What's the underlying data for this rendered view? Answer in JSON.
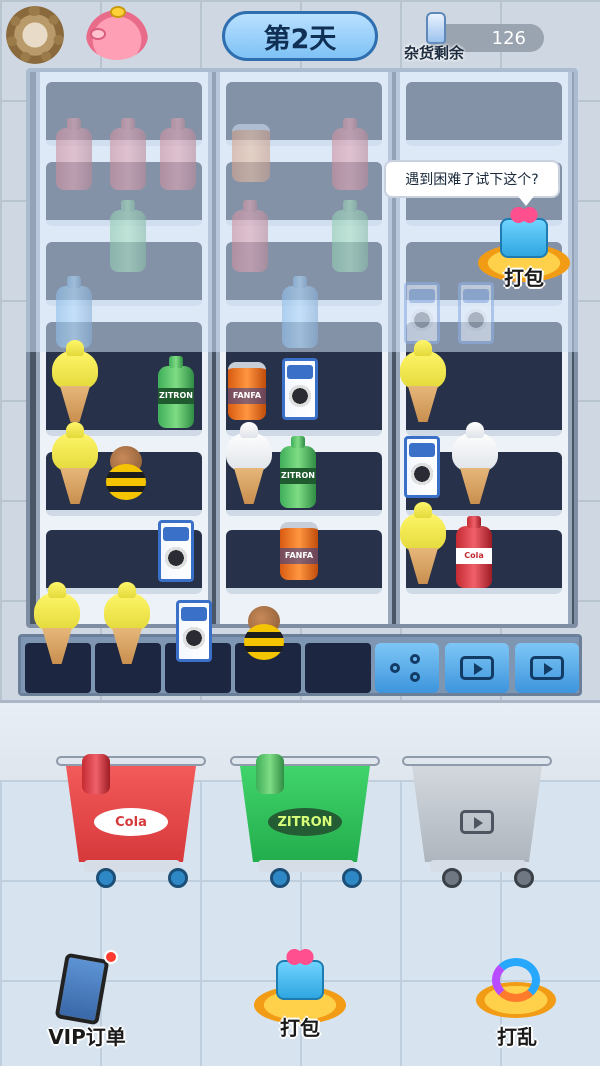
{
  "topbar": {
    "settings_icon": "gear-icon",
    "piggy_icon": "piggy-bank-icon",
    "day_label": "第2天",
    "stock_label": "杂货剩余",
    "stock_count": "126"
  },
  "hint": {
    "bubble_text": "遇到困难了试下这个?",
    "gift_label": "打包"
  },
  "shelf": {
    "column_count": 3,
    "items": [
      {
        "kind": "cone",
        "flavor": "yellow"
      },
      {
        "kind": "bottle",
        "brand": "ZITRON",
        "color": "green"
      },
      {
        "kind": "can",
        "brand": "FANFA"
      },
      {
        "kind": "milk",
        "brand": "OREO-MILK"
      },
      {
        "kind": "cone",
        "flavor": "yellow"
      },
      {
        "kind": "cone",
        "flavor": "yellow"
      },
      {
        "kind": "bee"
      },
      {
        "kind": "cone",
        "flavor": "white"
      },
      {
        "kind": "bottle",
        "brand": "ZITRON",
        "color": "green"
      },
      {
        "kind": "milk",
        "brand": "OREO-MILK"
      },
      {
        "kind": "cone",
        "flavor": "white"
      },
      {
        "kind": "milk",
        "brand": "OREO-MILK"
      },
      {
        "kind": "can",
        "brand": "FANFA"
      },
      {
        "kind": "cone",
        "flavor": "yellow"
      },
      {
        "kind": "bottle",
        "brand": "Cola",
        "color": "red"
      }
    ],
    "brand_labels": {
      "zitron": "ZITRON",
      "fanfa": "FANFA",
      "cola": "Cola"
    }
  },
  "tray": {
    "slots": [
      "cone-yellow",
      "cone-yellow",
      "milk",
      "bee",
      "empty"
    ],
    "tools": [
      {
        "name": "share",
        "icon": "share-icon"
      },
      {
        "name": "video-1",
        "icon": "video-icon"
      },
      {
        "name": "video-2",
        "icon": "video-icon"
      }
    ]
  },
  "carts": [
    {
      "brand": "Cola",
      "color": "#d7393b",
      "state": "active"
    },
    {
      "brand": "ZITRON",
      "color": "#22ad4c",
      "state": "active"
    },
    {
      "brand": "",
      "color": "#aeb5bd",
      "state": "locked-video"
    }
  ],
  "actions": {
    "vip_label": "VIP订单",
    "pack_label": "打包",
    "shuffle_label": "打乱"
  },
  "colors": {
    "accent_blue": "#3d95dc",
    "tray": "#7f96b3",
    "shelf_dark": "#27324a"
  }
}
